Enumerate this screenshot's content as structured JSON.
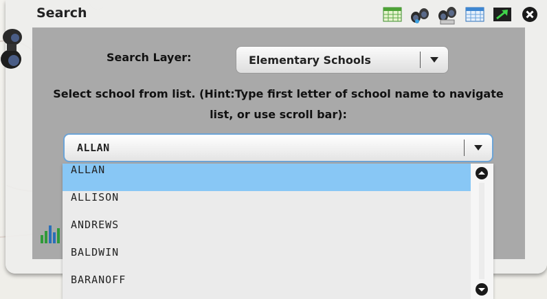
{
  "widget": {
    "title": "Search",
    "toolbar": [
      {
        "icon": "table-icon"
      },
      {
        "icon": "binoculars-icon"
      },
      {
        "icon": "binoculars-tool-icon"
      },
      {
        "icon": "grid-icon"
      },
      {
        "icon": "export-arrow-icon"
      },
      {
        "icon": "close-icon"
      }
    ]
  },
  "search": {
    "layer_label": "Search Layer:",
    "layer_value": "Elementary Schools",
    "hint": "Select school from list. (Hint:Type first letter of school name to navigate list, or use scroll bar):",
    "school_value": "ALLAN"
  },
  "dropdown": {
    "items": [
      "ALLAN",
      "ALLISON",
      "ANDREWS",
      "BALDWIN",
      "BARANOFF"
    ],
    "selected_index": 0
  },
  "colors": {
    "highlight": "#88c7f5",
    "focus_border": "#6ba3d6",
    "content_bg": "#a9a9a9"
  }
}
